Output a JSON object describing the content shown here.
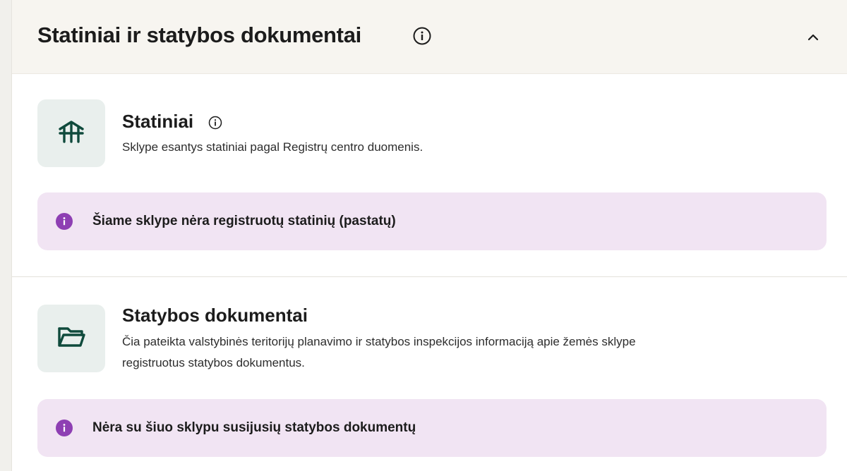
{
  "header": {
    "title": "Statiniai ir statybos dokumentai",
    "info_icon": "info-icon",
    "collapse_icon": "chevron-up-icon"
  },
  "buildings": {
    "title": "Statiniai",
    "description": "Sklype esantys statiniai pagal Registrų centro duomenis.",
    "icon": "building-icon",
    "info_icon": "info-icon",
    "notice": "Šiame sklype nėra registruotų statinių (pastatų)"
  },
  "documents": {
    "title": "Statybos dokumentai",
    "description_line1": "Čia pateikta valstybinės teritorijų planavimo ir statybos inspekcijos informaciją apie žemės sklype",
    "description_line2": "registruotus statybos dokumentus.",
    "icon": "folder-icon",
    "notice": "Nėra su šiuo sklypu susijusių statybos dokumentų"
  },
  "colors": {
    "header_bg": "#f7f5f0",
    "icon_box_bg": "#e9efed",
    "icon_green": "#0f4a3c",
    "notice_bg": "#f1e4f3",
    "notice_dot": "#8e3fb3"
  }
}
